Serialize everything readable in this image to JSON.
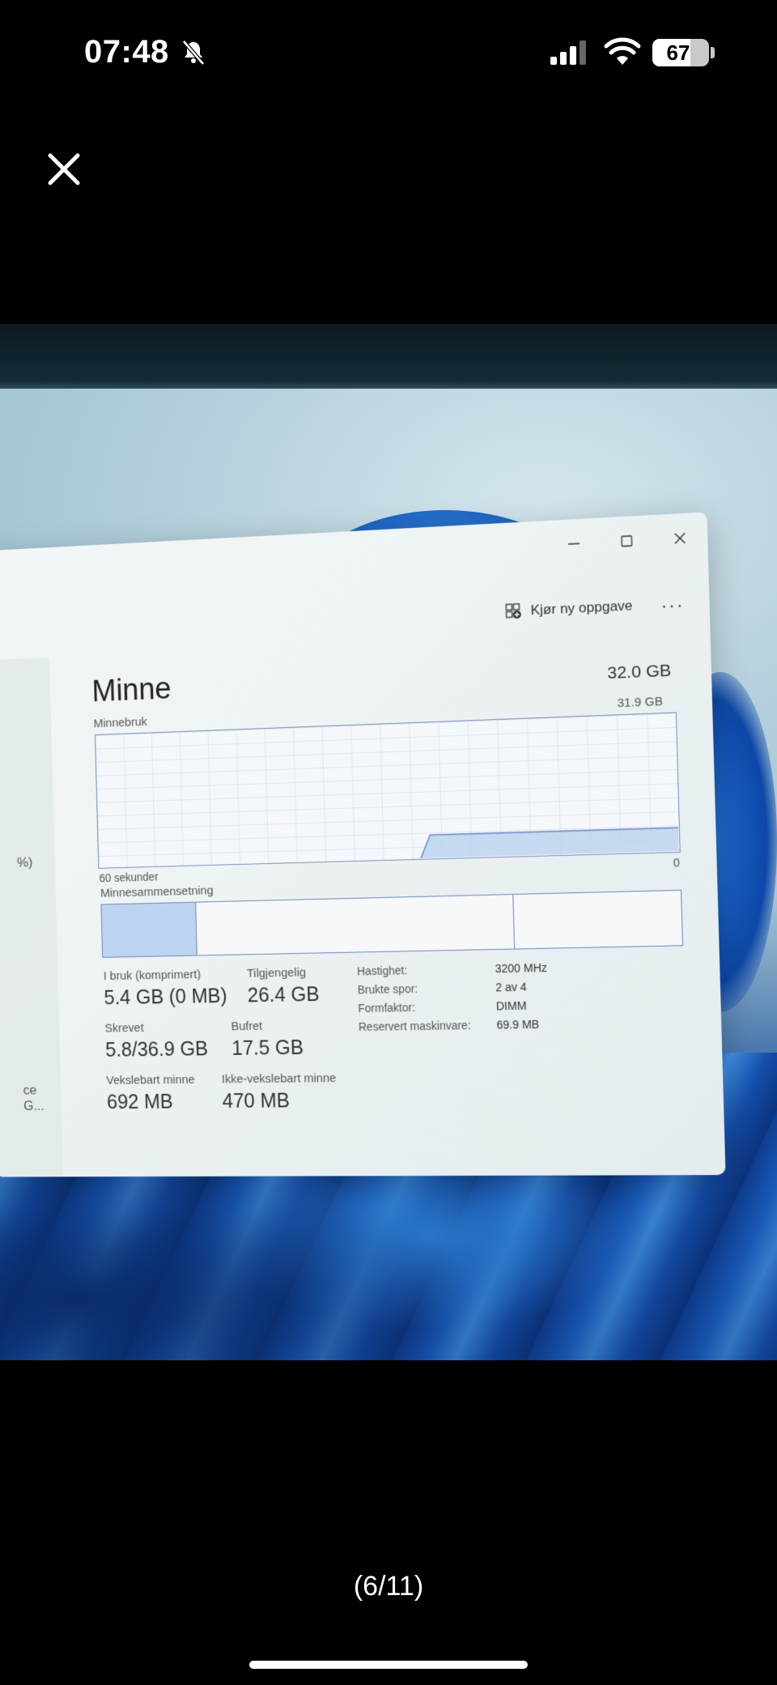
{
  "status_bar": {
    "time": "07:48",
    "battery": "67",
    "battery_level": 0.67,
    "icons": [
      "bell-slash-icon",
      "cellular-signal-icon",
      "wifi-icon",
      "battery-icon"
    ]
  },
  "viewer": {
    "close_icon": "close-icon",
    "page_counter": "(6/11)"
  },
  "window": {
    "left_pane": {
      "partial_percent": "%)",
      "partial_item": "ce G..."
    },
    "controls": [
      "minimize-icon",
      "maximize-icon",
      "close-icon"
    ],
    "toolbar": {
      "run_task_label": "Kjør ny oppgave",
      "more_label": "···"
    },
    "memory": {
      "title": "Minne",
      "total": "32.0 GB",
      "usage_label": "Minnebruk",
      "usage_max": "31.9 GB",
      "x_left": "60 sekunder",
      "x_right": "0",
      "composition_label": "Minnesammensetning",
      "stats": {
        "in_use_label": "I bruk (komprimert)",
        "in_use_value": "5.4 GB (0 MB)",
        "available_label": "Tilgjengelig",
        "available_value": "26.4 GB",
        "committed_label": "Skrevet",
        "committed_value": "5.8/36.9 GB",
        "cached_label": "Bufret",
        "cached_value": "17.5 GB",
        "paged_label": "Vekslebart minne",
        "paged_value": "692 MB",
        "nonpaged_label": "Ikke-vekslebart minne",
        "nonpaged_value": "470 MB"
      },
      "specs": {
        "speed_label": "Hastighet:",
        "speed_value": "3200 MHz",
        "slots_label": "Brukte spor:",
        "slots_value": "2 av 4",
        "form_label": "Formfaktor:",
        "form_value": "DIMM",
        "reserved_label": "Reservert maskinvare:",
        "reserved_value": "69.9 MB"
      },
      "colors": {
        "graph_line": "#6f86c2",
        "graph_fill": "#bcd4ef"
      }
    }
  },
  "chart_data": {
    "type": "area",
    "title": "Minnebruk",
    "xlabel": "",
    "ylabel": "",
    "x_range_labels": [
      "60 sekunder",
      "0"
    ],
    "ylim": [
      0,
      31.9
    ],
    "series": [
      {
        "values": [
          null,
          null,
          null,
          null,
          null,
          null,
          null,
          null,
          null,
          null,
          null,
          null,
          null,
          null,
          null,
          null,
          null,
          null,
          null,
          null,
          null,
          null,
          null,
          null,
          null,
          null,
          null,
          null,
          null,
          null,
          null,
          null,
          null,
          null,
          0,
          5.4,
          5.4,
          5.4,
          5.4,
          5.4,
          5.4,
          5.4,
          5.4,
          5.4,
          5.4,
          5.4,
          5.4,
          5.4,
          5.4,
          5.4,
          5.4,
          5.4,
          5.4,
          5.4,
          5.4,
          5.4,
          5.4,
          5.4,
          5.4,
          5.4,
          5.4
        ]
      }
    ],
    "composition": [
      {
        "value": 5.4
      },
      {
        "value": 17.5
      },
      {
        "value": 8.9
      }
    ]
  }
}
